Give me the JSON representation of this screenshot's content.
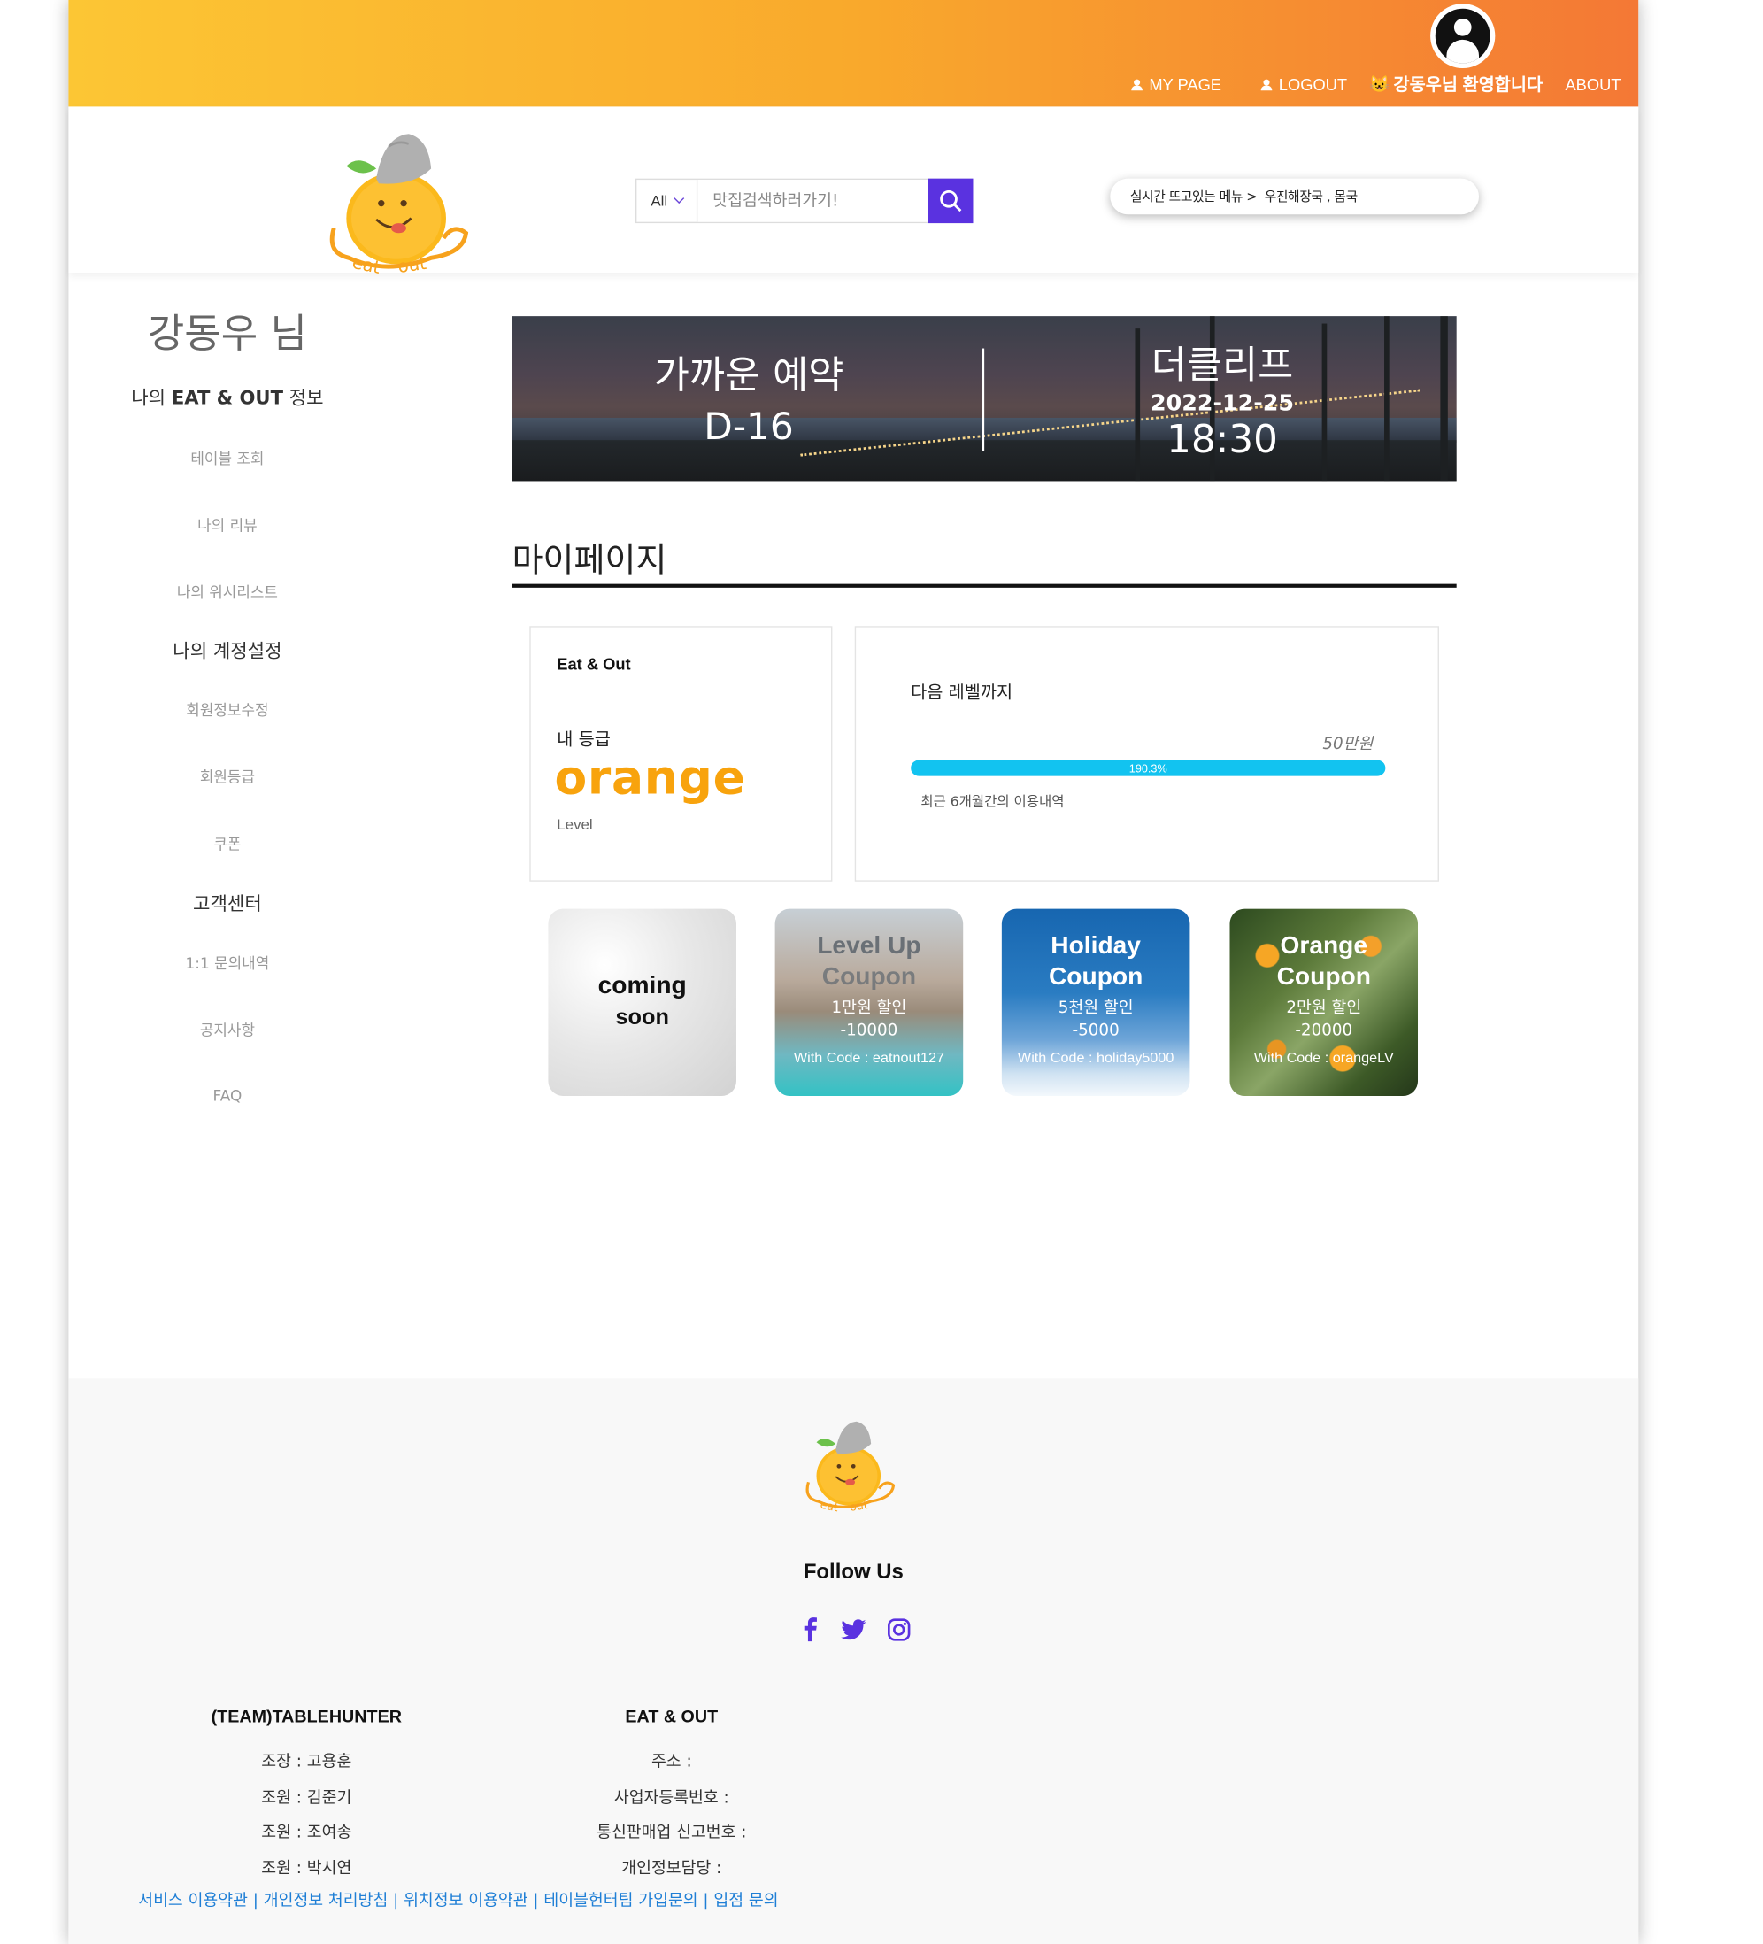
{
  "topnav": {
    "mypage": "MY PAGE",
    "logout": "LOGOUT",
    "welcome": "강동우님 환영합니다",
    "about": "ABOUT"
  },
  "header": {
    "search_scope": "All",
    "search_placeholder": "맛집검색하러가기!",
    "trend_label": "실시간 뜨고있는 메뉴 >",
    "trend_value": "우진해장국 , 몸국"
  },
  "sidebar": {
    "user_name": "강동우 님",
    "sec1_prefix": "나의 ",
    "sec1_brand": "EAT & OUT",
    "sec1_suffix": " 정보",
    "items1": [
      "테이블 조회",
      "나의 리뷰",
      "나의 위시리스트"
    ],
    "sec2": "나의 계정설정",
    "items2": [
      "회원정보수정",
      "회원등급",
      "쿠폰"
    ],
    "sec3": "고객센터",
    "items3": [
      "1:1 문의내역",
      "공지사항",
      "FAQ"
    ]
  },
  "banner": {
    "left_title": "가까운 예약",
    "left_dday": "D-16",
    "right_title": "더클리프",
    "right_date": "2022-12-25",
    "right_time": "18:30"
  },
  "main": {
    "page_title": "마이페이지"
  },
  "grade_card": {
    "brand": "Eat & Out",
    "label": "내 등급",
    "grade": "orange",
    "level": "Level",
    "grade_color": "#f8a30d"
  },
  "progress_card": {
    "title": "다음 레벨까지",
    "amount": "50만원",
    "progress_text": "190.3%",
    "progress_fraction": 1.0,
    "note": "최근 6개월간의 이용내역",
    "bar_color": "#12c3f0"
  },
  "coupons": [
    {
      "line1": "coming",
      "line2": "soon"
    },
    {
      "line1": "Level Up",
      "line2": "Coupon",
      "line3": "1만원 할인",
      "line4": "-10000",
      "line5": "With Code : eatnout127"
    },
    {
      "line1": "Holiday",
      "line2": "Coupon",
      "line3": "5천원 할인",
      "line4": "-5000",
      "line5": "With Code : holiday5000"
    },
    {
      "line1": "Orange",
      "line2": "Coupon",
      "line3": "2만원 할인",
      "line4": "-20000",
      "line5": "With Code : orangeLV"
    }
  ],
  "footer": {
    "follow": "Follow Us",
    "social": [
      "facebook-icon",
      "twitter-icon",
      "instagram-icon"
    ],
    "team_title": "(TEAM)TABLEHUNTER",
    "team_members": [
      "조장 : 고용훈",
      "조원 : 김준기",
      "조원 : 조여송",
      "조원 : 박시연"
    ],
    "company_title": "EAT & OUT",
    "company_info": [
      "주소 :",
      "사업자등록번호 :",
      "통신판매업 신고번호 :",
      "개인정보담당 :"
    ],
    "links": [
      "서비스 이용약관",
      "개인정보 처리방침",
      "위치정보 이용약관",
      "테이블헌터팀 가입문의",
      "입점 문의"
    ],
    "link_color": "#1f7fd6"
  },
  "colors": {
    "gradient_start": "#fcc634",
    "gradient_end": "#f47835",
    "accent_purple": "#5a32e0",
    "social_icon": "#5a32e0"
  }
}
